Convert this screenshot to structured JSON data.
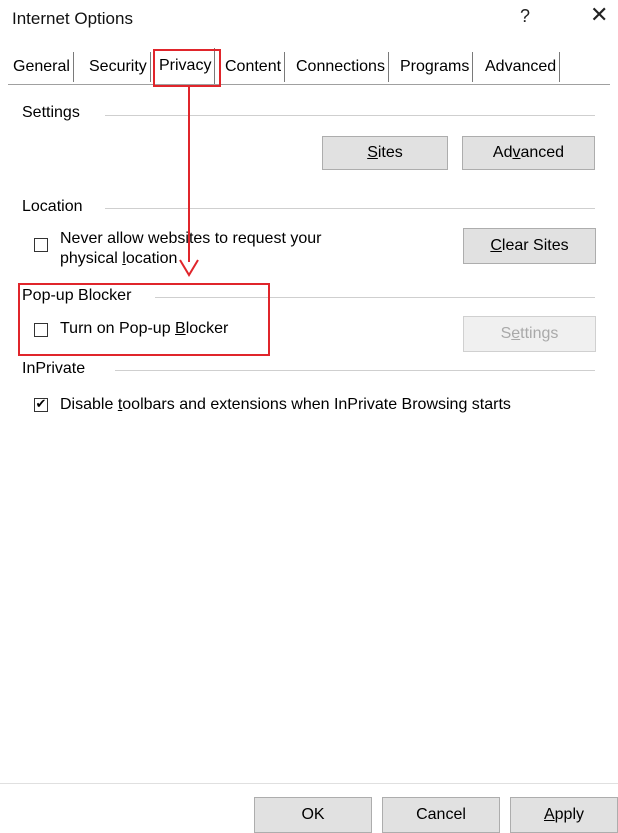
{
  "window": {
    "title": "Internet Options",
    "help_glyph": "?",
    "close_glyph": "✕"
  },
  "tabs": [
    {
      "label": "General"
    },
    {
      "label": "Security"
    },
    {
      "label": "Privacy",
      "selected": true
    },
    {
      "label": "Content"
    },
    {
      "label": "Connections"
    },
    {
      "label": "Programs"
    },
    {
      "label": "Advanced"
    }
  ],
  "settings": {
    "group_label": "Settings",
    "sites_button": {
      "pre": "",
      "key": "S",
      "post": "ites"
    },
    "advanced_button": {
      "pre": "Ad",
      "key": "v",
      "post": "anced"
    }
  },
  "location": {
    "group_label": "Location",
    "checkbox_line1": "Never allow websites to request your",
    "checkbox_line2_pre": "physical ",
    "checkbox_line2_key": "l",
    "checkbox_line2_post": "ocation",
    "checked": false,
    "clear_sites_button": {
      "pre": "",
      "key": "C",
      "post": "lear Sites"
    }
  },
  "popup": {
    "group_label": "Pop-up Blocker",
    "checkbox": {
      "pre": "Turn on Pop-up ",
      "key": "B",
      "post": "locker"
    },
    "checked": false,
    "settings_button": {
      "pre": "S",
      "key": "e",
      "post": "ttings"
    }
  },
  "inprivate": {
    "group_label": "InPrivate",
    "checkbox": {
      "pre": "Disable ",
      "key": "t",
      "post": "oolbars and extensions when InPrivate Browsing starts"
    },
    "checked": true,
    "check_glyph": "✔"
  },
  "footer": {
    "ok": "OK",
    "cancel": "Cancel",
    "apply": {
      "pre": "",
      "key": "A",
      "post": "pply"
    }
  },
  "colors": {
    "annotation": "#e0252b",
    "button_face": "#e1e1e1"
  }
}
